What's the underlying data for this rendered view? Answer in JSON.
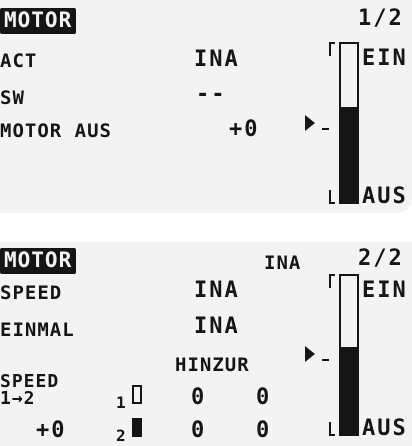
{
  "screen1": {
    "title": "MOTOR",
    "page": "1/2",
    "rows": [
      {
        "label": "ACT",
        "value": "INA"
      },
      {
        "label": "SW",
        "value": "--"
      },
      {
        "label": "MOTOR AUS",
        "value": "+0"
      }
    ],
    "gauge": {
      "top_label": "EIN",
      "bottom_label": "AUS",
      "level": 0.6
    }
  },
  "screen2": {
    "title": "MOTOR",
    "status": "INA",
    "page": "2/2",
    "rows": [
      {
        "label": "SPEED",
        "value": "INA"
      },
      {
        "label": "EINMAL",
        "value": "INA"
      }
    ],
    "hinzur_header": "HINZUR",
    "speed_label_line1": "SPEED",
    "speed_label_line2": "1→2",
    "speed_value": "+0",
    "speed_rows": [
      {
        "index": "1",
        "indicator": "empty",
        "hin": "0",
        "zur": "0"
      },
      {
        "index": "2",
        "indicator": "filled",
        "hin": "0",
        "zur": "0"
      }
    ],
    "gauge": {
      "top_label": "EIN",
      "bottom_label": "AUS",
      "level": 0.55
    }
  }
}
